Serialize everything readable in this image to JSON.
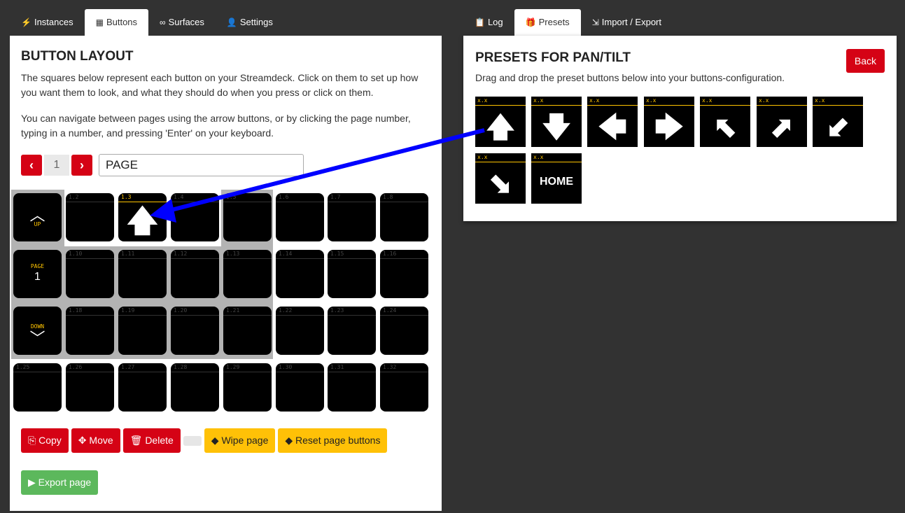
{
  "left_tabs": [
    {
      "label": "Instances",
      "icon": "plug-icon",
      "glyph": "⚡"
    },
    {
      "label": "Buttons",
      "icon": "calendar-grid-icon",
      "glyph": "▦"
    },
    {
      "label": "Surfaces",
      "icon": "gamepad-icon",
      "glyph": "∞"
    },
    {
      "label": "Settings",
      "icon": "user-cog-icon",
      "glyph": "👤"
    }
  ],
  "right_tabs": [
    {
      "label": "Log",
      "icon": "clipboard-icon",
      "glyph": "📋"
    },
    {
      "label": "Presets",
      "icon": "gift-icon",
      "glyph": "🎁"
    },
    {
      "label": "Import / Export",
      "icon": "import-icon",
      "glyph": "⇲"
    }
  ],
  "layout": {
    "title": "BUTTON LAYOUT",
    "desc1": "The squares below represent each button on your Streamdeck. Click on them to set up how you want them to look, and what they should do when you press or click on them.",
    "desc2": "You can navigate between pages using the arrow buttons, or by clicking the page number, typing in a number, and pressing 'Enter' on your keyboard.",
    "prev": "‹",
    "next": "›",
    "page_number": "1",
    "page_name": "PAGE"
  },
  "nav": {
    "up_label": "UP",
    "page_label": "PAGE",
    "page_value": "1",
    "down_label": "DOWN"
  },
  "buttons": [
    "1.2",
    "1.3",
    "1.4",
    "1.5",
    "1.6",
    "1.7",
    "1.8",
    "1.10",
    "1.11",
    "1.12",
    "1.13",
    "1.14",
    "1.15",
    "1.16",
    "1.18",
    "1.19",
    "1.20",
    "1.21",
    "1.22",
    "1.23",
    "1.24",
    "1.25",
    "1.26",
    "1.27",
    "1.28",
    "1.29",
    "1.30",
    "1.31",
    "1.32"
  ],
  "assigned_button": {
    "id": "1.3",
    "symbol": "🡅"
  },
  "actions": {
    "copy": "Copy",
    "move": "Move",
    "delete": "Delete",
    "wipe": "Wipe page",
    "reset": "Reset page buttons",
    "export": "Export page"
  },
  "presets": {
    "title": "PRESETS FOR PAN/TILT",
    "desc": "Drag and drop the preset buttons below into your buttons-configuration.",
    "back": "Back",
    "items": [
      {
        "label": "x.x",
        "icon": "arrow-up-icon",
        "symbol": "🡅"
      },
      {
        "label": "x.x",
        "icon": "arrow-down-icon",
        "symbol": "🡇"
      },
      {
        "label": "x.x",
        "icon": "arrow-left-icon",
        "symbol": "🡄"
      },
      {
        "label": "x.x",
        "icon": "arrow-right-icon",
        "symbol": "🡆"
      },
      {
        "label": "x.x",
        "icon": "arrow-up-left-icon",
        "symbol": "⬉"
      },
      {
        "label": "x.x",
        "icon": "arrow-up-right-icon",
        "symbol": "⬈"
      },
      {
        "label": "x.x",
        "icon": "arrow-down-left-icon",
        "symbol": "⬋"
      },
      {
        "label": "x.x",
        "icon": "arrow-down-right-icon",
        "symbol": "⬊"
      },
      {
        "label": "x.x",
        "text": "HOME"
      }
    ]
  },
  "colors": {
    "accent_red": "#d50215",
    "warning_yellow": "#ffc107",
    "success_green": "#5cb85c",
    "button_label_yellow": "#ffc400",
    "drag_arrow_blue": "#0000ff"
  }
}
